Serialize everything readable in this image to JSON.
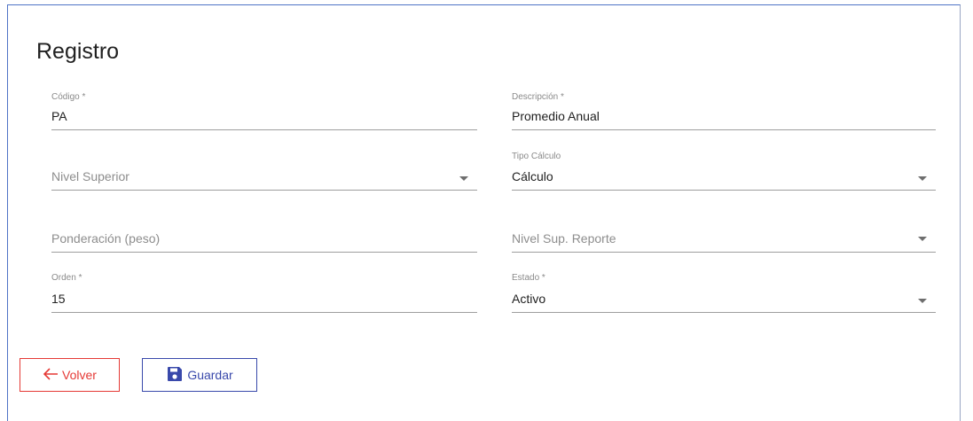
{
  "form": {
    "title": "Registro",
    "codigo": {
      "label": "Código *",
      "value": "PA"
    },
    "descripcion": {
      "label": "Descripción *",
      "value": "Promedio Anual"
    },
    "nivel_superior": {
      "placeholder": "Nivel Superior"
    },
    "tipo_calculo": {
      "label": "Tipo Cálculo",
      "value": "Cálculo"
    },
    "ponderacion": {
      "placeholder": "Ponderación (peso)"
    },
    "nivel_sup_reporte": {
      "placeholder": "Nivel Sup. Reporte"
    },
    "orden": {
      "label": "Orden *",
      "value": "15"
    },
    "estado": {
      "label": "Estado *",
      "value": "Activo"
    }
  },
  "actions": {
    "back_label": "Volver",
    "save_label": "Guardar",
    "back_icon": "arrow-left-icon",
    "save_icon": "floppy-disk-icon",
    "back_color": "#e53935",
    "save_color": "#3949ab"
  }
}
